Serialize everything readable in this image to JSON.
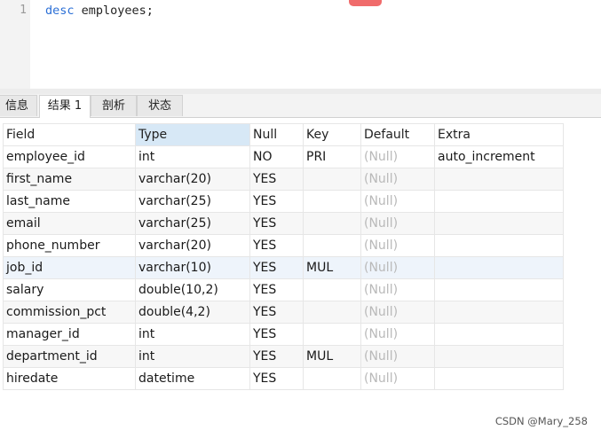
{
  "editor": {
    "line_number": "1",
    "code_keyword": "desc",
    "code_rest": " employees;"
  },
  "tabs": [
    {
      "label": "信息"
    },
    {
      "label": "结果 1"
    },
    {
      "label": "剖析"
    },
    {
      "label": "状态"
    }
  ],
  "grid": {
    "headers": [
      "Field",
      "Type",
      "Null",
      "Key",
      "Default",
      "Extra"
    ],
    "rows": [
      [
        "employee_id",
        "int",
        "NO",
        "PRI",
        "(Null)",
        "auto_increment"
      ],
      [
        "first_name",
        "varchar(20)",
        "YES",
        "",
        "(Null)",
        ""
      ],
      [
        "last_name",
        "varchar(25)",
        "YES",
        "",
        "(Null)",
        ""
      ],
      [
        "email",
        "varchar(25)",
        "YES",
        "",
        "(Null)",
        ""
      ],
      [
        "phone_number",
        "varchar(20)",
        "YES",
        "",
        "(Null)",
        ""
      ],
      [
        "job_id",
        "varchar(10)",
        "YES",
        "MUL",
        "(Null)",
        ""
      ],
      [
        "salary",
        "double(10,2)",
        "YES",
        "",
        "(Null)",
        ""
      ],
      [
        "commission_pct",
        "double(4,2)",
        "YES",
        "",
        "(Null)",
        ""
      ],
      [
        "manager_id",
        "int",
        "YES",
        "",
        "(Null)",
        ""
      ],
      [
        "department_id",
        "int",
        "YES",
        "MUL",
        "(Null)",
        ""
      ],
      [
        "hiredate",
        "datetime",
        "YES",
        "",
        "(Null)",
        ""
      ]
    ]
  },
  "watermark": "CSDN @Mary_258",
  "colors": {
    "keyword": "#2b6fd6",
    "null_text": "#b9b9b9",
    "sorted_header": "#d7e8f6",
    "selected_row": "#eef4fb",
    "accent_tab": "#f06b6b"
  }
}
